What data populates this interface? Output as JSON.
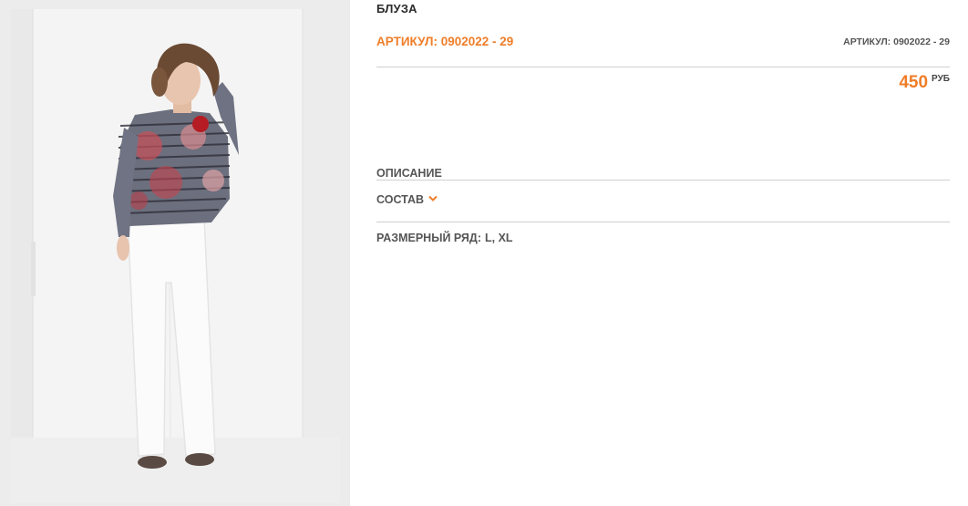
{
  "product": {
    "name": "БЛУЗА",
    "sku_main": "АРТИКУЛ: 0902022 - 29",
    "sku_small": "АРТИКУЛ: 0902022 - 29",
    "price": "450",
    "currency": "РУБ"
  },
  "sections": {
    "description": "ОПИСАНИЕ",
    "composition": "СОСТАВ",
    "size_label": "РАЗМЕРНЫЙ РЯД:",
    "sizes": "L, XL"
  },
  "colors": {
    "accent": "#ef7d28",
    "text": "#555555",
    "rule": "#cfcfcf"
  },
  "icons": {
    "composition_toggle": "chevron-down-icon"
  }
}
